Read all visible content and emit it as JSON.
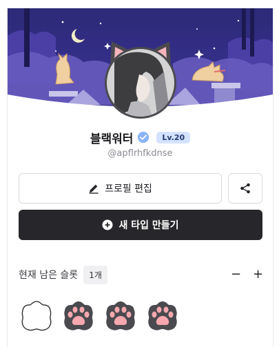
{
  "profile": {
    "name": "블랙워터",
    "level": "Lv.20",
    "handle": "@apflrhfkdnse"
  },
  "actions": {
    "edit_label": "프로필 편집",
    "new_type_label": "새 타입 만들기"
  },
  "slots": {
    "label": "현재 남은 슬롯",
    "count": "1개",
    "decrease": "−",
    "increase": "+",
    "items": [
      {
        "state": "empty"
      },
      {
        "state": "filled"
      },
      {
        "state": "filled"
      },
      {
        "state": "filled"
      }
    ]
  },
  "colors": {
    "banner_sky": "#2f2a7d",
    "banner_cloud": "#6a5dbf",
    "verified": "#8ab4f8",
    "level_bg": "#d3e2ff",
    "primary_button": "#27272b",
    "paw_dark": "#4a4a4f",
    "paw_pink": "#f6a8ae"
  }
}
